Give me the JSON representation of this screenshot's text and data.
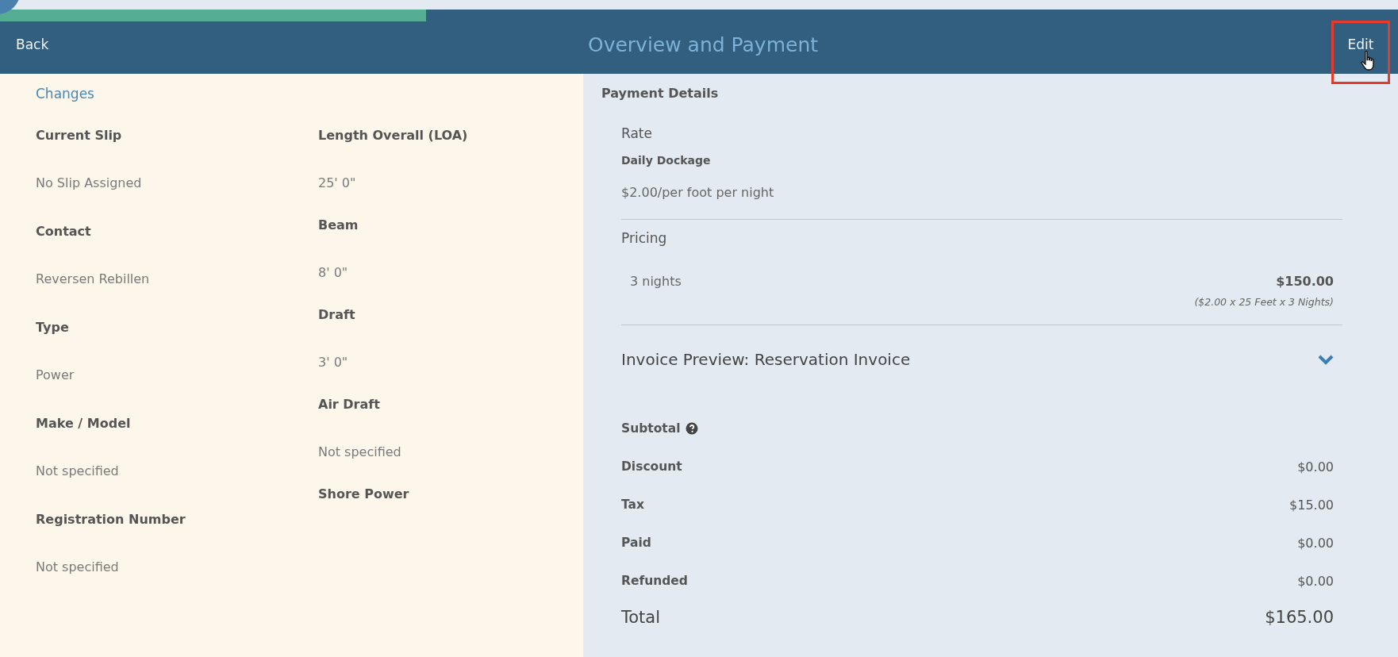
{
  "progress": {
    "level": 0.305
  },
  "header": {
    "back": "Back",
    "title": "Overview and Payment",
    "edit": "Edit",
    "edit_highlighted": true
  },
  "changes": {
    "title": "Changes",
    "columns": [
      [
        {
          "label": "Current Slip",
          "value": "No Slip Assigned"
        },
        {
          "label": "Contact",
          "value": "Reversen Rebillen"
        },
        {
          "label": "Type",
          "value": "Power"
        },
        {
          "label": "Make / Model",
          "value": "Not specified"
        },
        {
          "label": "Registration Number",
          "value": "Not specified"
        }
      ],
      [
        {
          "label": "Length Overall (LOA)",
          "value": "25' 0\""
        },
        {
          "label": "Beam",
          "value": "8' 0\""
        },
        {
          "label": "Draft",
          "value": "3' 0\""
        },
        {
          "label": "Air Draft",
          "value": "Not specified"
        },
        {
          "label": "Shore Power"
        }
      ]
    ]
  },
  "payment": {
    "title": "Payment Details",
    "rate": {
      "title": "Rate",
      "name": "Daily Dockage",
      "price": "$2.00/per foot per night"
    },
    "pricing": {
      "title": "Pricing",
      "items": [
        {
          "label": "3 nights",
          "amount": "$150.00",
          "detail": "($2.00 x 25 Feet x 3 Nights)"
        }
      ]
    },
    "invoice": {
      "title": "Invoice Preview: Reservation Invoice",
      "expanded": true,
      "lines": [
        {
          "kind": "help",
          "label": "Subtotal"
        },
        {
          "kind": "line",
          "label": "Discount",
          "amount": "$0.00"
        },
        {
          "kind": "line",
          "label": "Tax",
          "amount": "$15.00"
        },
        {
          "kind": "line",
          "label": "Paid",
          "amount": "$0.00"
        },
        {
          "kind": "line",
          "label": "Refunded",
          "amount": "$0.00"
        },
        {
          "kind": "total",
          "label": "Total",
          "amount": "$165.00"
        }
      ]
    }
  }
}
